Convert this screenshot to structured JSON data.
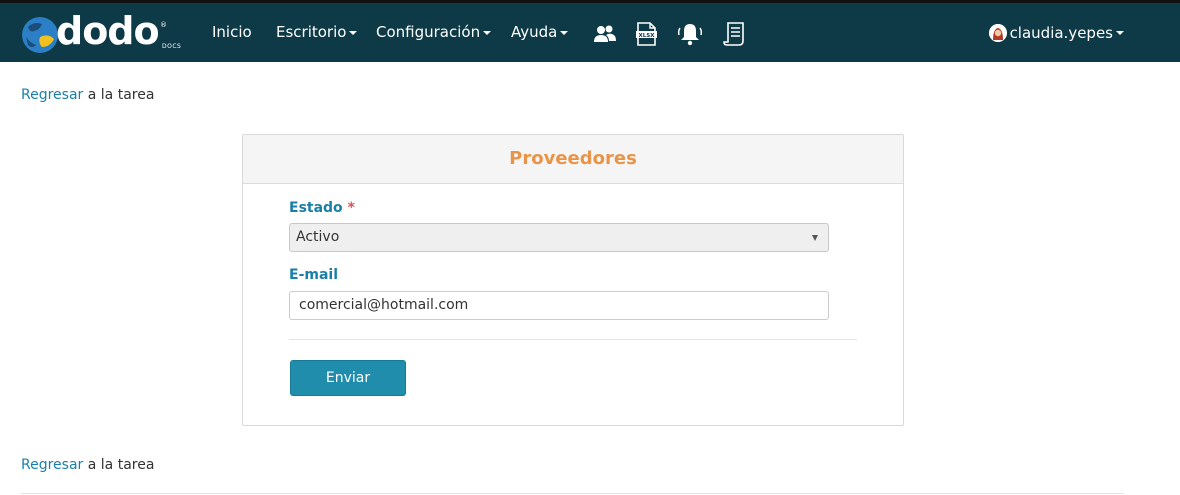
{
  "nav": {
    "brand": "dodo",
    "brand_sub": "DOCS",
    "brand_mark": "®",
    "items": [
      {
        "label": "Inicio",
        "dropdown": false
      },
      {
        "label": "Escritorio",
        "dropdown": true
      },
      {
        "label": "Configuración",
        "dropdown": true
      },
      {
        "label": "Ayuda",
        "dropdown": true
      }
    ],
    "icons": [
      "users-icon",
      "xlsx-file-icon",
      "bell-icon",
      "document-list-icon"
    ],
    "icon_xlsx_text": "XLSX",
    "user": "claudia.yepes",
    "bg_color": "#0d3a46"
  },
  "back_link": {
    "link_text": "Regresar",
    "rest_text": "a la tarea"
  },
  "form": {
    "title": "Proveedores",
    "estado_label": "Estado",
    "required_mark": "*",
    "estado_value": "Activo",
    "email_label": "E-mail",
    "email_value": "comercial@hotmail.com",
    "submit_label": "Enviar"
  },
  "colors": {
    "accent": "#1a7fa8",
    "title": "#e8954a",
    "button": "#1f8dab"
  }
}
